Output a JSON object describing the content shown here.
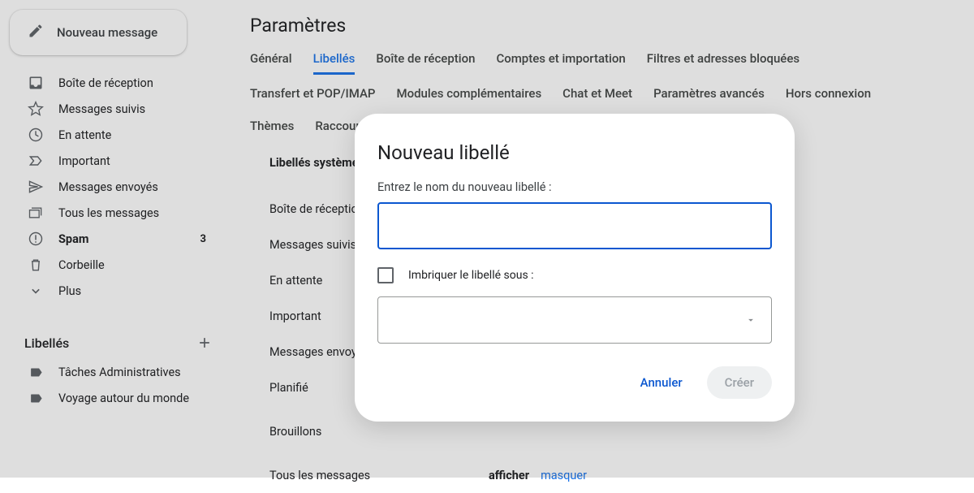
{
  "sidebar": {
    "compose_label": "Nouveau message",
    "items": [
      {
        "label": "Boîte de réception"
      },
      {
        "label": "Messages suivis"
      },
      {
        "label": "En attente"
      },
      {
        "label": "Important"
      },
      {
        "label": "Messages envoyés"
      },
      {
        "label": "Tous les messages"
      },
      {
        "label": "Spam",
        "bold": true,
        "badge": "3"
      },
      {
        "label": "Corbeille"
      },
      {
        "label": "Plus"
      }
    ],
    "labels_header": "Libellés",
    "user_labels": [
      {
        "label": "Tâches Administratives"
      },
      {
        "label": "Voyage autour du monde"
      }
    ]
  },
  "main": {
    "title": "Paramètres",
    "tabs": [
      "Général",
      "Libellés",
      "Boîte de réception",
      "Comptes et importation",
      "Filtres et adresses bloquées",
      "Transfert et POP/IMAP",
      "Modules complémentaires",
      "Chat et Meet",
      "Paramètres avancés",
      "Hors connexion",
      "Thèmes",
      "Raccourcis clavier"
    ],
    "active_tab_index": 1,
    "section_title": "Libellés système",
    "rows": [
      {
        "label": "Boîte de réception"
      },
      {
        "label": "Messages suivis"
      },
      {
        "label": "En attente"
      },
      {
        "label": "Important"
      },
      {
        "label": "Messages envoyés"
      },
      {
        "label": "Planifié"
      },
      {
        "label": "Brouillons"
      },
      {
        "label": "Tous les messages",
        "show": "afficher",
        "hide": "masquer"
      }
    ]
  },
  "modal": {
    "title": "Nouveau libellé",
    "field_label": "Entrez le nom du nouveau libellé :",
    "input_value": "",
    "nest_label": "Imbriquer le libellé sous :",
    "cancel_label": "Annuler",
    "create_label": "Créer"
  }
}
